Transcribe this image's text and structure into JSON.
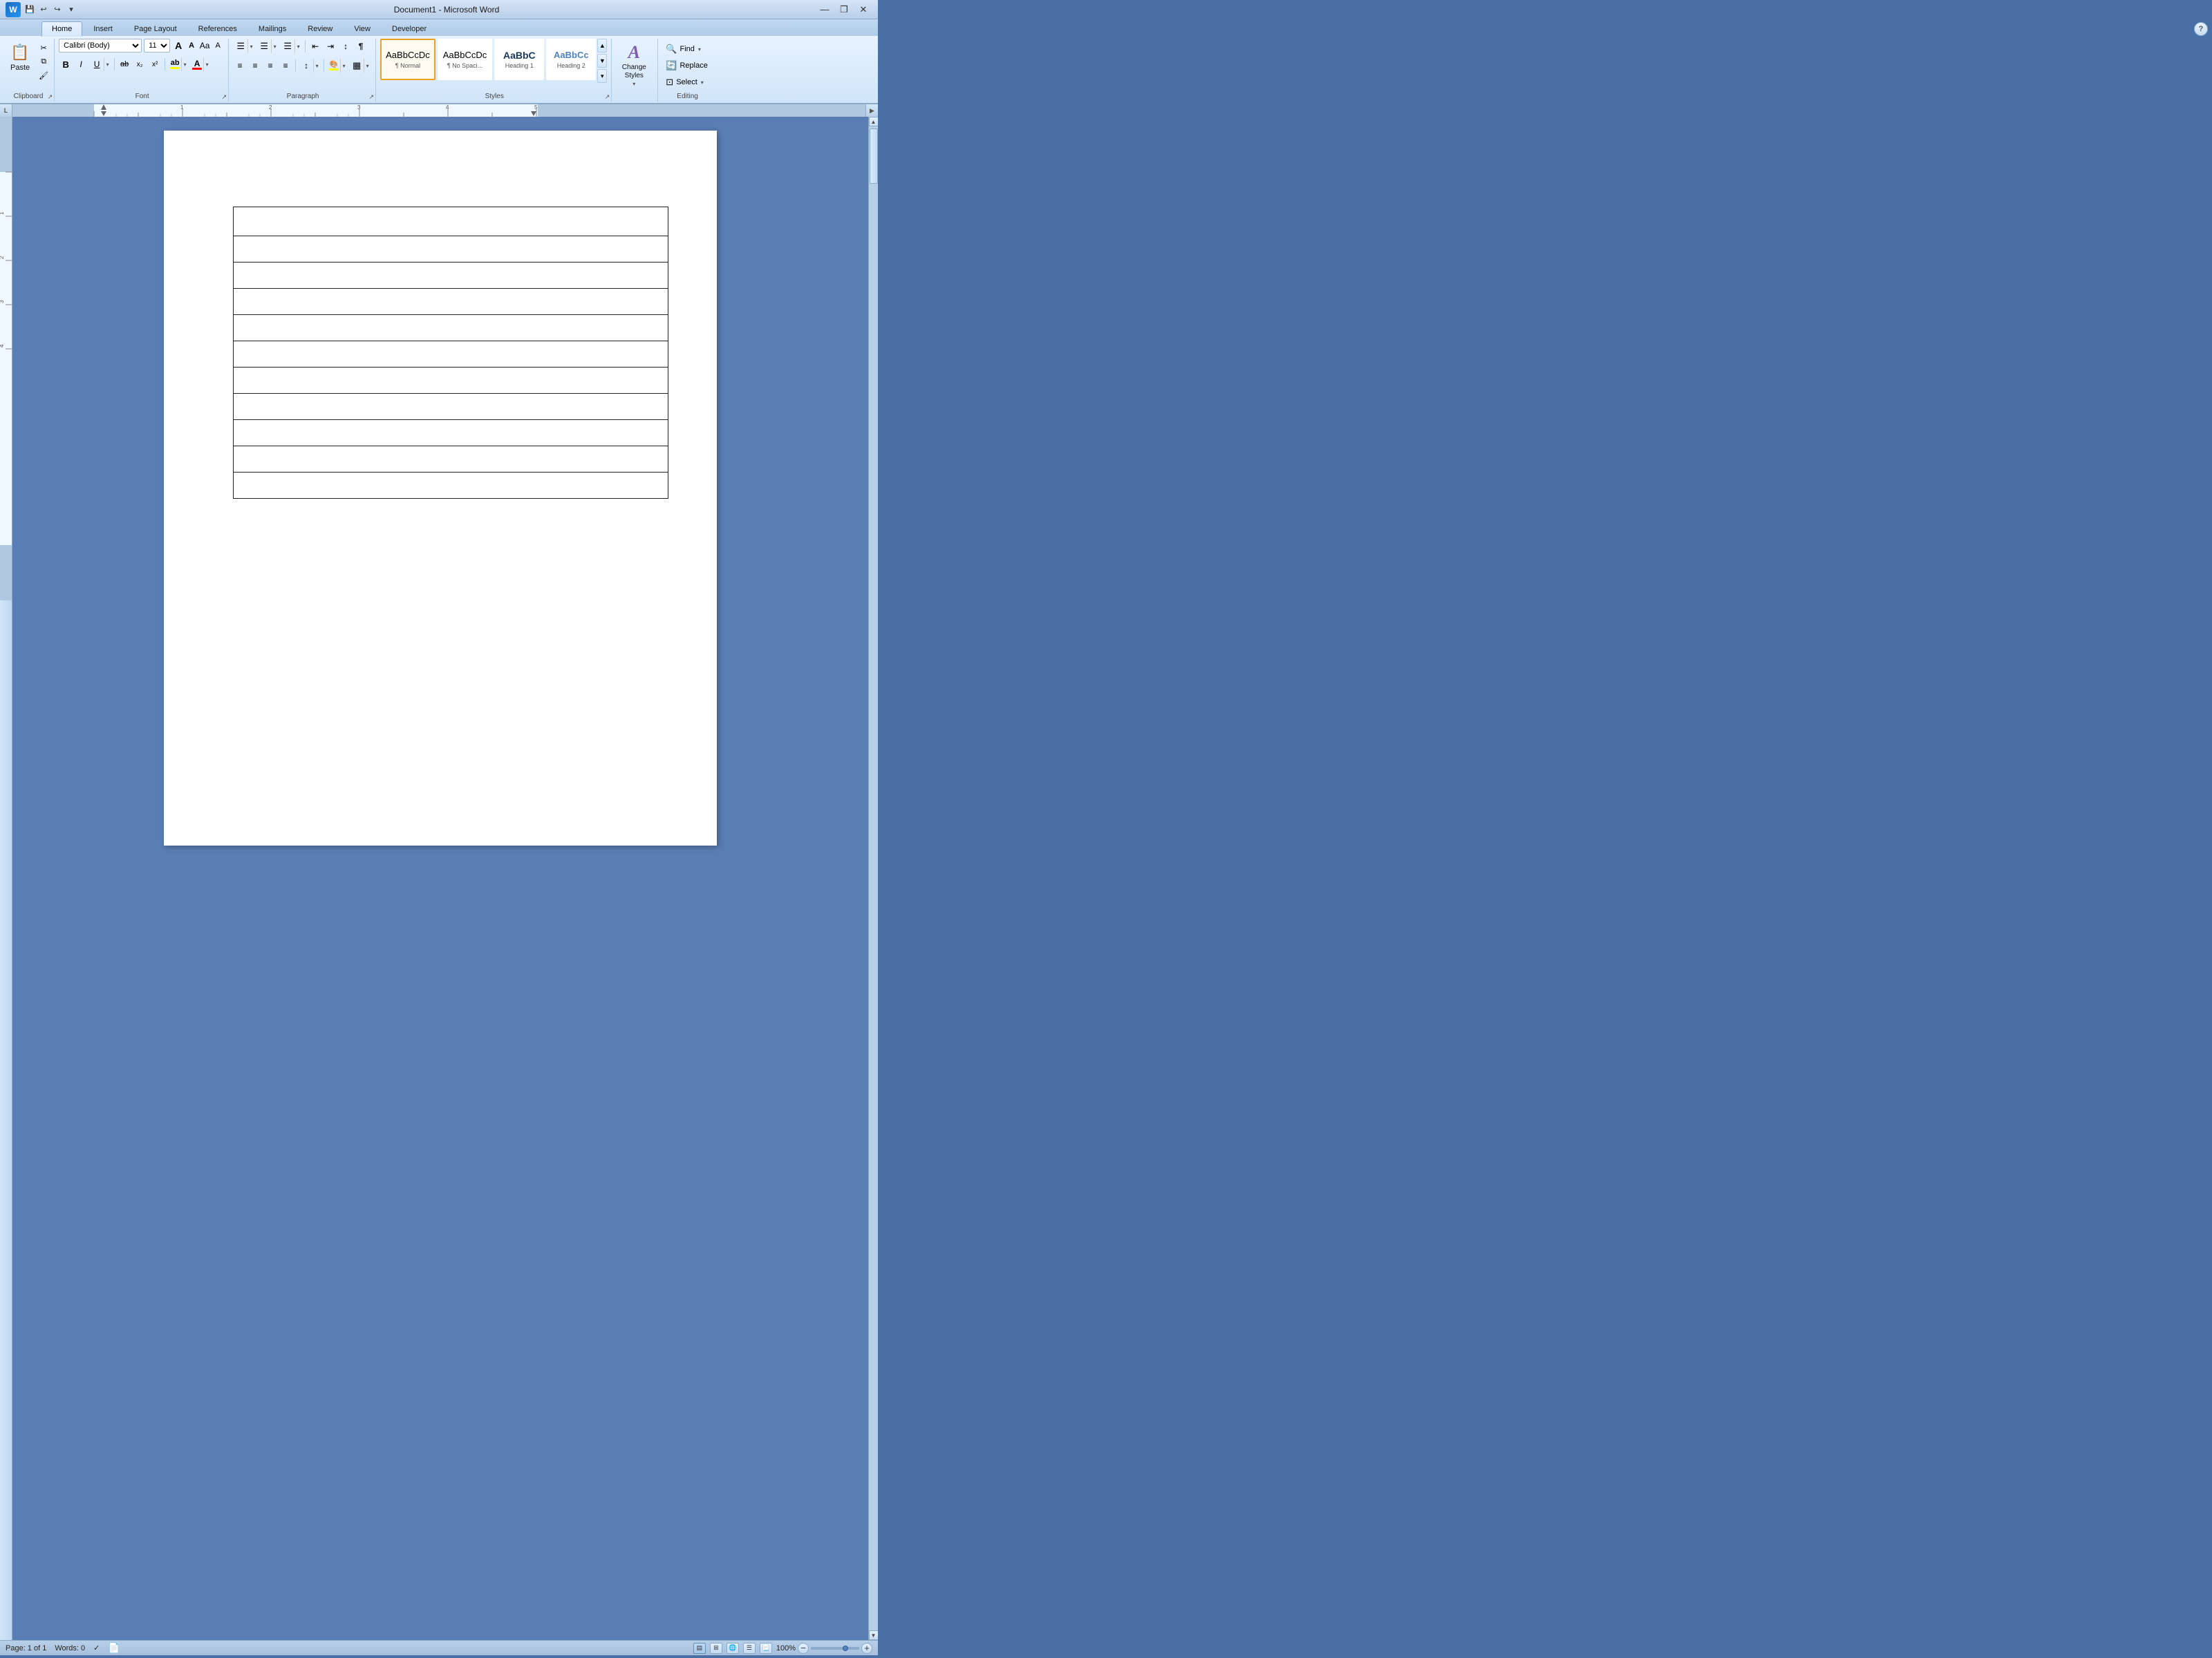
{
  "titleBar": {
    "title": "Document1 - Microsoft Word",
    "appIconLabel": "W",
    "quickAccess": {
      "save": "💾",
      "undo": "↩",
      "redo": "↪",
      "dropdown": "▾"
    },
    "windowControls": {
      "minimize": "—",
      "restore": "❐",
      "close": "✕"
    }
  },
  "tabs": [
    {
      "label": "Home",
      "active": true
    },
    {
      "label": "Insert",
      "active": false
    },
    {
      "label": "Page Layout",
      "active": false
    },
    {
      "label": "References",
      "active": false
    },
    {
      "label": "Mailings",
      "active": false
    },
    {
      "label": "Review",
      "active": false
    },
    {
      "label": "View",
      "active": false
    },
    {
      "label": "Developer",
      "active": false
    }
  ],
  "ribbon": {
    "clipboard": {
      "label": "Clipboard",
      "paste": "Paste",
      "cut": "✂",
      "copy": "⧉",
      "formatPainter": "🖌"
    },
    "font": {
      "label": "Font",
      "fontName": "Calibri (Body)",
      "fontSize": "11",
      "growIcon": "A",
      "shrinkIcon": "A",
      "clearFormatIcon": "A",
      "bold": "B",
      "italic": "I",
      "underline": "U",
      "strikethrough": "ab",
      "subscript": "x₂",
      "superscript": "x²",
      "changeCase": "Aa",
      "highlight": "ab",
      "fontColor": "A"
    },
    "paragraph": {
      "label": "Paragraph",
      "bulletList": "≡",
      "numberedList": "≡",
      "multiLevelList": "≡",
      "decreaseIndent": "⇤",
      "increaseIndent": "⇥",
      "sort": "↕",
      "showHide": "¶",
      "alignLeft": "≡",
      "alignCenter": "≡",
      "alignRight": "≡",
      "justify": "≡",
      "lineSpacing": "↕",
      "shading": "🎨",
      "borders": "▦"
    },
    "styles": {
      "label": "Styles",
      "items": [
        {
          "preview": "AaBbCcDc",
          "name": "¶ Normal",
          "active": true,
          "color": "#000"
        },
        {
          "preview": "AaBbCcDc",
          "name": "¶ No Spaci...",
          "active": false,
          "color": "#000"
        },
        {
          "preview": "AaBbC",
          "name": "Heading 1",
          "active": false,
          "color": "#17375e"
        },
        {
          "preview": "AaBbCc",
          "name": "Heading 2",
          "active": false,
          "color": "#4f81bd"
        }
      ]
    },
    "changeStyles": {
      "label": "Change\nStyles",
      "icon": "A"
    },
    "editing": {
      "label": "Editing",
      "find": "Find",
      "replace": "Replace",
      "select": "Select"
    }
  },
  "ruler": {
    "cornerLabel": "L",
    "unit": "inches"
  },
  "statusBar": {
    "pageInfo": "Page: 1 of 1",
    "wordCount": "Words: 0",
    "proofing": "✓",
    "viewButtons": [
      "📄",
      "🔲",
      "📖",
      "📃",
      "🔍"
    ],
    "zoom": "100%",
    "zoomMinus": "—",
    "zoomPlus": "+"
  },
  "document": {
    "tableRows": 11,
    "tableCols": 1
  }
}
